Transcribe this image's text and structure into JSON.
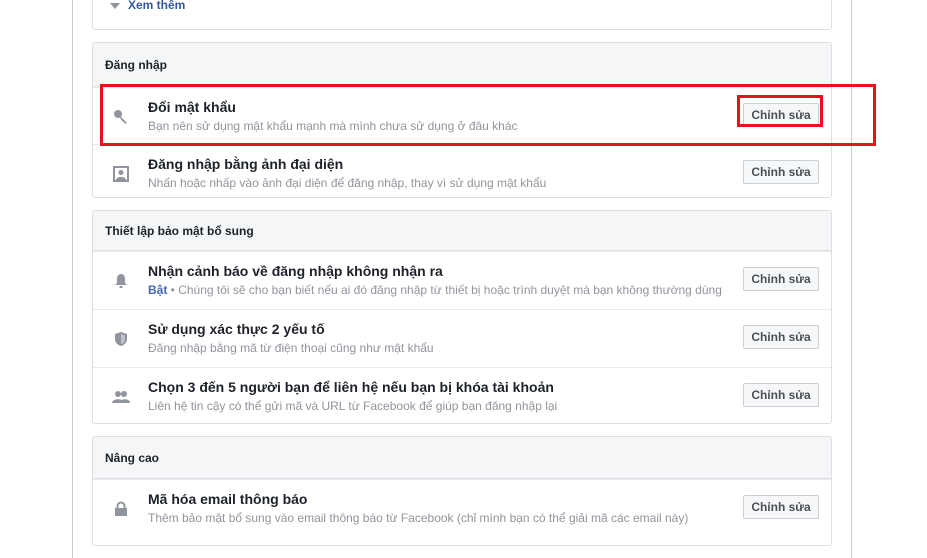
{
  "top_panel": {
    "see_more": "Xem thêm"
  },
  "sections": [
    {
      "header": "Đăng nhập",
      "rows": [
        {
          "title": "Đổi mật khẩu",
          "sub": "Bạn nên sử dụng mật khẩu mạnh mà mình chưa sử dụng ở đâu khác",
          "button": "Chỉnh sửa",
          "icon": "key-icon"
        },
        {
          "title": "Đăng nhập bằng ảnh đại diện",
          "sub": "Nhấn hoặc nhấp vào ảnh đại diện để đăng nhập, thay vì sử dụng mật khẩu",
          "button": "Chỉnh sửa",
          "icon": "profile-picture-icon"
        }
      ]
    },
    {
      "header": "Thiết lập bảo mật bổ sung",
      "rows": [
        {
          "title": "Nhận cảnh báo về đăng nhập không nhận ra",
          "status": "Bật",
          "sub": " • Chúng tôi sẽ cho bạn biết nếu ai đó đăng nhập từ thiết bị hoặc trình duyệt mà bạn không thường dùng",
          "button": "Chỉnh sửa",
          "icon": "bell-icon"
        },
        {
          "title": "Sử dụng xác thực 2 yếu tố",
          "sub": "Đăng nhập bằng mã từ điện thoại cũng như mật khẩu",
          "button": "Chỉnh sửa",
          "icon": "shield-icon"
        },
        {
          "title": "Chọn 3 đến 5 người bạn để liên hệ nếu bạn bị khóa tài khoản",
          "sub": "Liên hệ tin cậy có thể gửi mã và URL từ Facebook để giúp bạn đăng nhập lại",
          "button": "Chỉnh sửa",
          "icon": "friends-icon"
        }
      ]
    },
    {
      "header": "Nâng cao",
      "rows": [
        {
          "title": "Mã hóa email thông báo",
          "sub": "Thêm bảo mật bổ sung vào email thông báo từ Facebook (chỉ mình bạn có thể giải mã các email này)",
          "button": "Chỉnh sửa",
          "icon": "lock-icon"
        }
      ]
    }
  ],
  "colors": {
    "highlight": "#e8121f",
    "link": "#365899",
    "status_on": "#4267b2"
  }
}
